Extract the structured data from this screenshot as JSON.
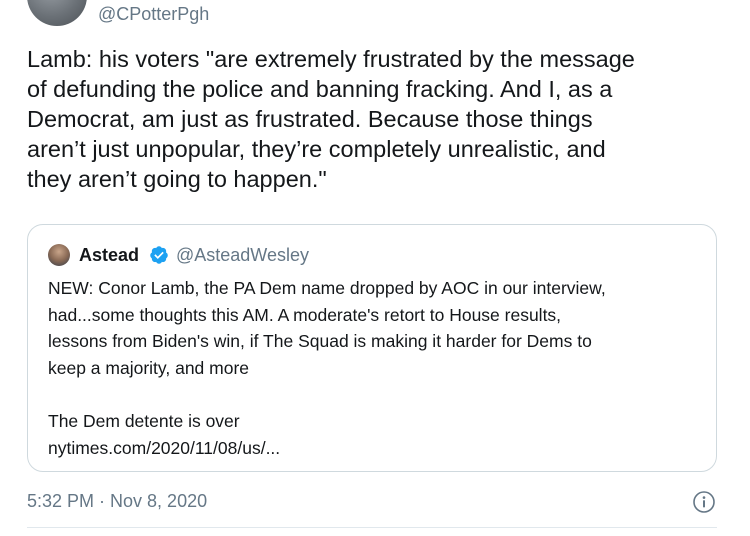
{
  "author": {
    "handle": "@CPotterPgh"
  },
  "tweet": {
    "text": "Lamb: his voters \"are extremely frustrated by the message\nof defunding the police and banning fracking. And I, as a\nDemocrat, am just as frustrated. Because those things\naren’t just unpopular, they’re completely unrealistic, and\nthey aren’t going to happen.\"",
    "timestamp": "5:32 PM · Nov 8, 2020"
  },
  "quoted_tweet": {
    "name": "Astead",
    "handle": "@AsteadWesley",
    "verified": true,
    "text": "NEW: Conor Lamb, the PA Dem name dropped by AOC in our interview,\nhad...some thoughts this AM. A moderate's retort to House results,\nlessons from Biden's win, if The Squad is making it harder for Dems to\nkeep a majority, and more",
    "link_title": "The Dem detente is over",
    "link_url": "nytimes.com/2020/11/08/us/..."
  },
  "icons": {
    "verified": "verified-badge-icon",
    "info": "info-icon"
  },
  "colors": {
    "text": "#14171a",
    "secondary": "#657786",
    "verified_blue": "#1da1f2",
    "border": "#cfd9de"
  }
}
